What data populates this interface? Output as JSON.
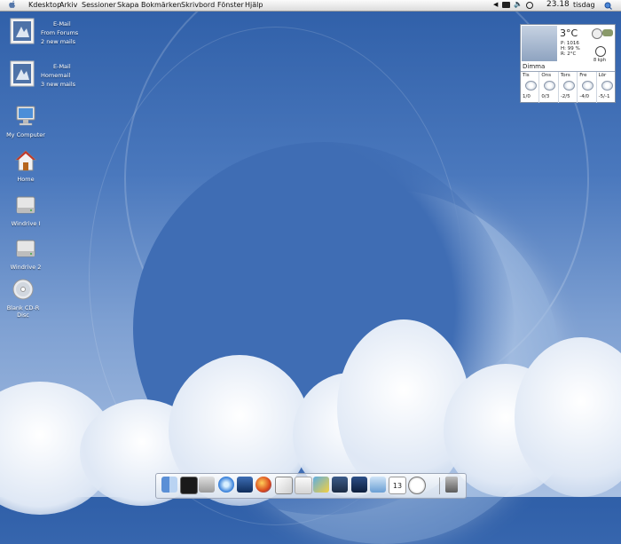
{
  "menubar": {
    "items": [
      "Kdesktop",
      "Arkiv",
      "Sessioner",
      "Skapa",
      "Bokmärken",
      "Skrivbord",
      "Fönster",
      "Hjälp"
    ],
    "clock": "23.18",
    "day": "tisdag"
  },
  "mail_widgets": [
    {
      "title": "E-Mail",
      "account": "From Forums",
      "count": "2 new mails"
    },
    {
      "title": "E-Mail",
      "account": "Homemail",
      "count": "3 new mails"
    }
  ],
  "desktop_icons": [
    {
      "label": "My Computer",
      "icon": "computer-icon"
    },
    {
      "label": "Home",
      "icon": "home-icon"
    },
    {
      "label": "Windrive I",
      "icon": "drive-icon"
    },
    {
      "label": "Windrive 2",
      "icon": "drive-icon"
    },
    {
      "label": "Blank CD-R Disc",
      "icon": "cd-icon"
    }
  ],
  "weather": {
    "temperature": "3°C",
    "pressure": "P: 1016",
    "humidity": "H: 99 %",
    "dew": "R: 2°C",
    "wind": "8 kph",
    "condition": "Dimma",
    "forecast": [
      {
        "day": "Tis",
        "temps": "1/0"
      },
      {
        "day": "Ons",
        "temps": "0/3"
      },
      {
        "day": "Tors",
        "temps": "-2/5"
      },
      {
        "day": "Fre",
        "temps": "-4/0"
      },
      {
        "day": "Lör",
        "temps": "-5/-1"
      }
    ]
  },
  "dock": {
    "items": [
      "finder-icon",
      "terminal-icon",
      "system-preferences-icon",
      "itunes-icon",
      "browser-icon",
      "firefox-icon",
      "text-editor-icon",
      "documents-icon",
      "photo-icon",
      "movies-icon",
      "video-icon",
      "music-icon",
      "calendar-icon",
      "clock-icon",
      "trash-icon"
    ],
    "calendar_day": "13"
  }
}
